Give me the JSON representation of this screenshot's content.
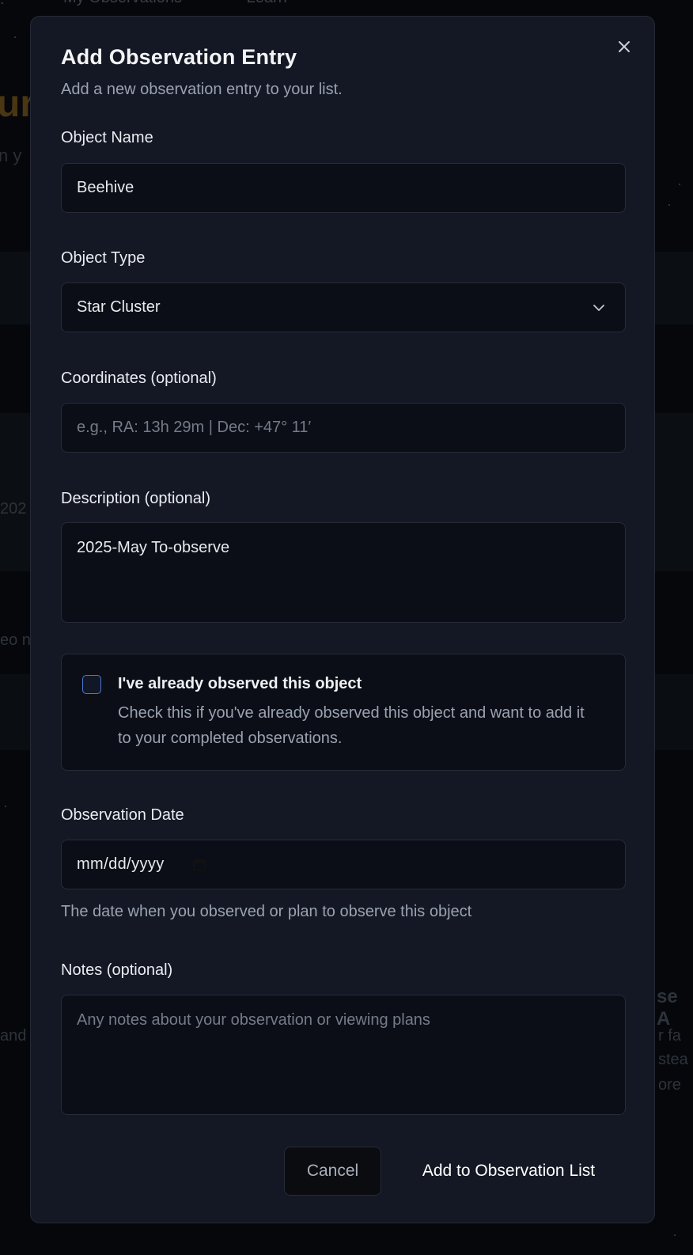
{
  "background": {
    "nav": [
      "My Observations",
      "Learn"
    ],
    "hero_fragment": "ur",
    "hero_sub_fragment": "n y",
    "fragment_1": "202",
    "fragment_2": "eo n",
    "fragment_3": "and",
    "fragment_4": "se A",
    "fragment_5": "r fa",
    "fragment_6": "stea",
    "fragment_7": "ore"
  },
  "modal": {
    "title": "Add Observation Entry",
    "subtitle": "Add a new observation entry to your list.",
    "close_icon": "x-icon",
    "object_name": {
      "label": "Object Name",
      "value": "Beehive"
    },
    "object_type": {
      "label": "Object Type",
      "value": "Star Cluster",
      "icon": "chevron-down-icon"
    },
    "coordinates": {
      "label": "Coordinates (optional)",
      "placeholder": "e.g., RA: 13h 29m | Dec: +47° 11′"
    },
    "description": {
      "label": "Description (optional)",
      "value": "2025-May To-observe"
    },
    "observed": {
      "checked": false,
      "title": "I've already observed this object",
      "description": "Check this if you've already observed this object and want to add it to your completed observations."
    },
    "observation_date": {
      "label": "Observation Date",
      "placeholder": "mm/dd/yyyy",
      "icon": "calendar-icon",
      "hint": "The date when you observed or plan to observe this object"
    },
    "notes": {
      "label": "Notes (optional)",
      "placeholder": "Any notes about your observation or viewing plans"
    },
    "actions": {
      "cancel": "Cancel",
      "submit": "Add to Observation List"
    }
  },
  "colors": {
    "modal_bg": "#141824",
    "field_bg": "#0b0e16",
    "border": "#262b37",
    "checkbox_accent": "#4b78d1",
    "muted_text": "#9aa2b1"
  }
}
